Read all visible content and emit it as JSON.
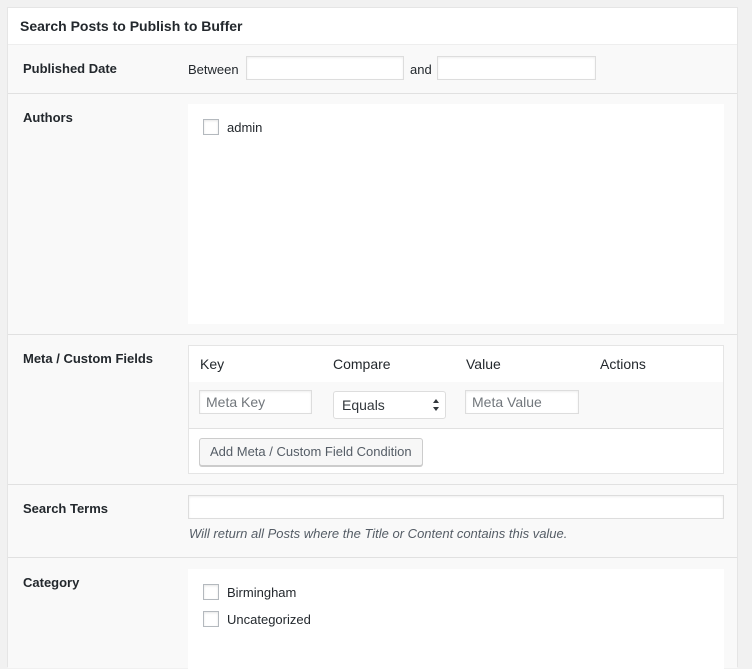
{
  "panel": {
    "title": "Search Posts to Publish to Buffer"
  },
  "published_date": {
    "label": "Published Date",
    "between_label": "Between",
    "and_label": "and",
    "start_value": "",
    "end_value": ""
  },
  "authors": {
    "label": "Authors",
    "items": [
      {
        "label": "admin",
        "checked": false
      }
    ]
  },
  "meta_fields": {
    "label": "Meta / Custom Fields",
    "headers": {
      "key": "Key",
      "compare": "Compare",
      "value": "Value",
      "actions": "Actions"
    },
    "row": {
      "key_placeholder": "Meta Key",
      "compare_selected": "Equals",
      "value_placeholder": "Meta Value"
    },
    "add_button_label": "Add Meta / Custom Field Condition"
  },
  "search_terms": {
    "label": "Search Terms",
    "value": "",
    "hint": "Will return all Posts where the Title or Content contains this value."
  },
  "category": {
    "label": "Category",
    "items": [
      {
        "label": "Birmingham",
        "checked": false
      },
      {
        "label": "Uncategorized",
        "checked": false
      }
    ]
  }
}
